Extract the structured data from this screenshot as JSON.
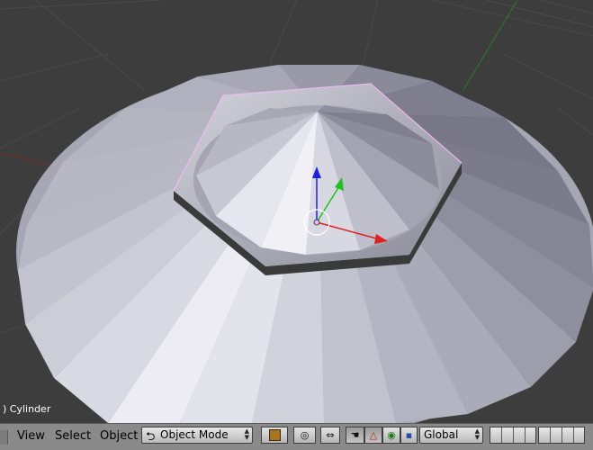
{
  "viewport": {
    "object_name": ") Cylinder"
  },
  "header": {
    "menus": {
      "view": "View",
      "select": "Select",
      "object": "Object"
    },
    "mode_select": {
      "value": "Object Mode",
      "icon": "object-mode-icon"
    },
    "orientation_select": {
      "value": "Global"
    }
  },
  "colors": {
    "grid_background": "#3d3d3d",
    "mesh_light": "#c9c9d6",
    "mesh_dark": "#6e6e7c",
    "selection_outline": "#f0b8f0",
    "x_axis": "#e02020",
    "y_axis": "#20c020",
    "z_axis": "#2020e0",
    "header_background": "#8a8a8a"
  }
}
